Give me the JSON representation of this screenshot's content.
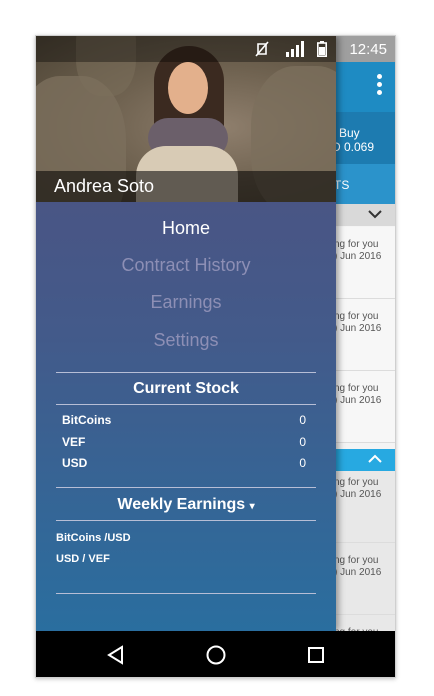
{
  "status_bar": {
    "time": "12:45"
  },
  "background_app": {
    "buy_label": "Buy",
    "buy_value": "D 0.069",
    "tab_fragment": "TS",
    "rows": [
      {
        "line1": "ng for you",
        "line2": ") Jun 2016"
      },
      {
        "line1": "ng for you",
        "line2": ") Jun 2016"
      },
      {
        "line1": "ng for you",
        "line2": ") Jun 2016"
      },
      {
        "line1": "ng for you",
        "line2": ") Jun 2016"
      },
      {
        "line1": "ng for you",
        "line2": ") Jun 2016"
      },
      {
        "line1": "ng for you",
        "line2": ""
      }
    ]
  },
  "drawer": {
    "user_name": "Andrea Soto",
    "menu": [
      {
        "label": "Home"
      },
      {
        "label": "Contract History"
      },
      {
        "label": "Earnings"
      },
      {
        "label": "Settings"
      }
    ],
    "current_stock": {
      "title": "Current Stock",
      "rows": [
        {
          "label": "BitCoins",
          "value": "0"
        },
        {
          "label": "VEF",
          "value": "0"
        },
        {
          "label": "USD",
          "value": "0"
        }
      ]
    },
    "weekly_earnings": {
      "title": "Weekly Earnings",
      "caret": "▾",
      "rows": [
        {
          "label": "BitCoins /USD"
        },
        {
          "label": "USD / VEF"
        }
      ]
    }
  },
  "colors": {
    "drawer_top": "#514f7e",
    "drawer_bottom": "#2a6e9f",
    "toolbar_blue": "#1e8bc3",
    "accent_blue": "#27a9e1"
  }
}
